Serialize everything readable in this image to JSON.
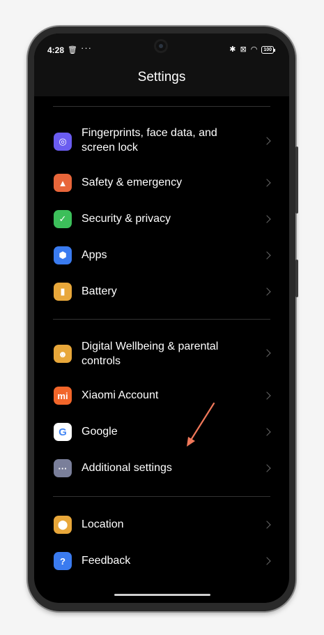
{
  "status_bar": {
    "time": "4:28",
    "trash_glyph": "🗑",
    "dots": "···",
    "bluetooth_glyph": "✱",
    "sim_glyph": "⊠",
    "wifi_glyph": "◠",
    "battery_level": "100"
  },
  "header": {
    "title": "Settings"
  },
  "groups": [
    {
      "items": [
        {
          "label": "Fingerprints, face data, and screen lock",
          "icon": "fingerprint-icon",
          "color": "#6a5cf0",
          "glyph": "◎"
        },
        {
          "label": "Safety & emergency",
          "icon": "emergency-icon",
          "color": "#e8663a",
          "glyph": "▲"
        },
        {
          "label": "Security & privacy",
          "icon": "shield-check-icon",
          "color": "#3cbf5a",
          "glyph": "✓"
        },
        {
          "label": "Apps",
          "icon": "apps-hexagon-icon",
          "color": "#3a7bf0",
          "glyph": "⬢"
        },
        {
          "label": "Battery",
          "icon": "battery-icon",
          "color": "#e8a73a",
          "glyph": "▮"
        }
      ]
    },
    {
      "items": [
        {
          "label": "Digital Wellbeing & parental controls",
          "icon": "wellbeing-icon",
          "color": "#e8a73a",
          "glyph": "☻"
        },
        {
          "label": "Xiaomi Account",
          "icon": "xiaomi-mi-icon",
          "color": "#f2662a",
          "glyph": "mi"
        },
        {
          "label": "Google",
          "icon": "google-g-icon",
          "color": "#ffffff",
          "glyph": "G"
        },
        {
          "label": "Additional settings",
          "icon": "more-dots-icon",
          "color": "#7a7f9a",
          "glyph": "···"
        }
      ]
    },
    {
      "items": [
        {
          "label": "Location",
          "icon": "location-pin-icon",
          "color": "#e8a73a",
          "glyph": "⬤"
        },
        {
          "label": "Feedback",
          "icon": "feedback-icon",
          "color": "#3a7bf0",
          "glyph": "?"
        }
      ]
    }
  ],
  "annotation": {
    "color": "#f0785a"
  }
}
